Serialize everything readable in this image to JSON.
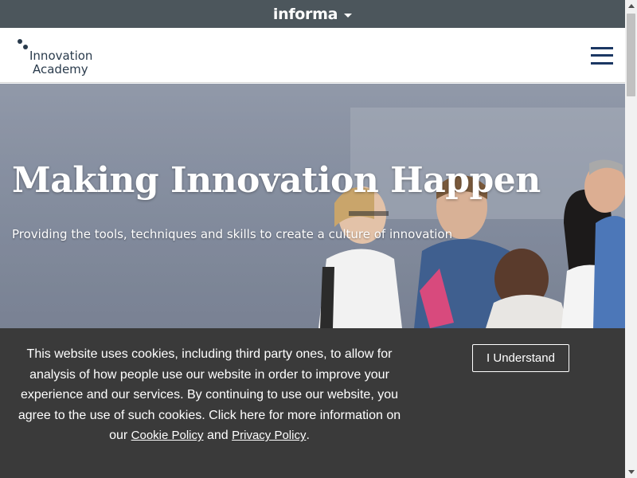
{
  "informa_bar": {
    "brand": "informa",
    "dropdown_icon": "caret-down-icon",
    "background": "#4c565c"
  },
  "header": {
    "logo_line1": "Innovation",
    "logo_line2": "Academy",
    "logo_color": "#2a3b4c",
    "menu_icon": "hamburger-menu-icon",
    "menu_color": "#1b3763"
  },
  "hero": {
    "title": "Making Innovation Happen",
    "subtitle": "Providing the tools, techniques and skills to create a culture of innovation"
  },
  "cookie_banner": {
    "text_before": "This website uses cookies, including third party ones, to allow for analysis of how people use our website in order to improve your experience and our services. By continuing to use our website, you agree to the use of such cookies. Click here for more information on our ",
    "cookie_policy_link": "Cookie Policy",
    "and_text": " and ",
    "privacy_policy_link": "Privacy Policy",
    "end_text": ".",
    "button_label": "I Understand",
    "background": "#3a3a3a"
  },
  "scrollbar": {
    "up_icon": "scroll-up-arrow-icon",
    "down_icon": "scroll-down-arrow-icon"
  }
}
